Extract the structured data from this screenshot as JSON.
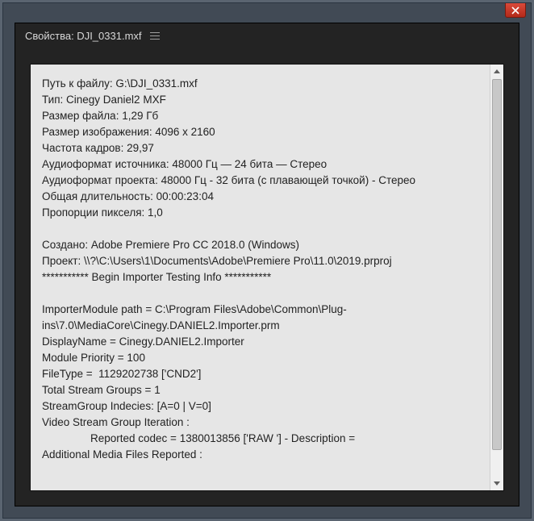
{
  "window": {
    "title": "Свойства: DJI_0331.mxf"
  },
  "props": {
    "file_path_label": "Путь к файлу: ",
    "file_path": "G:\\DJI_0331.mxf",
    "type_label": "Тип: ",
    "type": "Cinegy Daniel2 MXF",
    "file_size_label": "Размер файла: ",
    "file_size": "1,29 Гб",
    "image_size_label": "Размер изображения: ",
    "image_size": "4096 x 2160",
    "frame_rate_label": "Частота кадров: ",
    "frame_rate": "29,97",
    "src_audio_label": "Аудиоформат источника: ",
    "src_audio": "48000 Гц — 24 бита — Стерео",
    "proj_audio_label": "Аудиоформат проекта: ",
    "proj_audio": "48000 Гц - 32 бита (с плавающей точкой) - Стерео",
    "duration_label": "Общая длительность: ",
    "duration": "00:00:23:04",
    "par_label": "Пропорции пикселя: ",
    "par": "1,0",
    "created_label": "Создано: ",
    "created": "Adobe Premiere Pro CC 2018.0 (Windows)",
    "project_label": "Проект: ",
    "project": "\\\\?\\C:\\Users\\1\\Documents\\Adobe\\Premiere Pro\\11.0\\2019.prproj",
    "divider": "*********** Begin Importer Testing Info ***********",
    "imp_path_label": "ImporterModule path = ",
    "imp_path": "C:\\Program Files\\Adobe\\Common\\Plug-ins\\7.0\\MediaCore\\Cinegy.DANIEL2.Importer.prm",
    "disp_name_label": "DisplayName = ",
    "disp_name": "Cinegy.DANIEL2.Importer",
    "mod_prio_label": "Module Priority = ",
    "mod_prio": "100",
    "file_type_label": "FileType =  ",
    "file_type": "1129202738 ['CND2']",
    "tsg_label": "Total Stream Groups = ",
    "tsg": "1",
    "sgi_label": "StreamGroup Indecies: ",
    "sgi": "[A=0 | V=0]",
    "vsgi": "Video Stream Group Iteration :",
    "codec_label": "Reported codec = ",
    "codec": "1380013856 ['RAW '] - Description = ",
    "amfr": "Additional Media Files Reported :"
  }
}
